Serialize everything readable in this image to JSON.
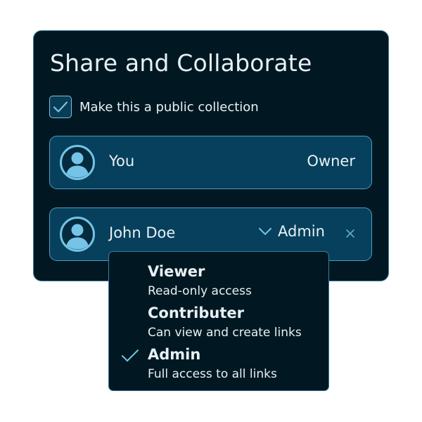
{
  "dialog": {
    "title": "Share and Collaborate",
    "public_checkbox": {
      "label": "Make this a public collection",
      "checked": true
    }
  },
  "members": [
    {
      "name": "You",
      "role": "Owner",
      "avatar_icon": "user-avatar-icon"
    },
    {
      "name": "John Doe",
      "role": "Admin",
      "avatar_icon": "user-avatar-icon",
      "dropdown_icon": "chevron-down-icon",
      "remove_icon": "close-icon"
    }
  ],
  "role_menu": {
    "options": [
      {
        "title": "Viewer",
        "description": "Read-only access",
        "selected": false
      },
      {
        "title": "Contributer",
        "description": "Can view and create links",
        "selected": false
      },
      {
        "title": "Admin",
        "description": "Full access to all links",
        "selected": true
      }
    ]
  },
  "colors": {
    "background": "#ffffff",
    "panel": "#011823",
    "row": "#07405c",
    "border": "#4f9cc0",
    "accent": "#75c4e8",
    "text": "#e8f1f5"
  }
}
